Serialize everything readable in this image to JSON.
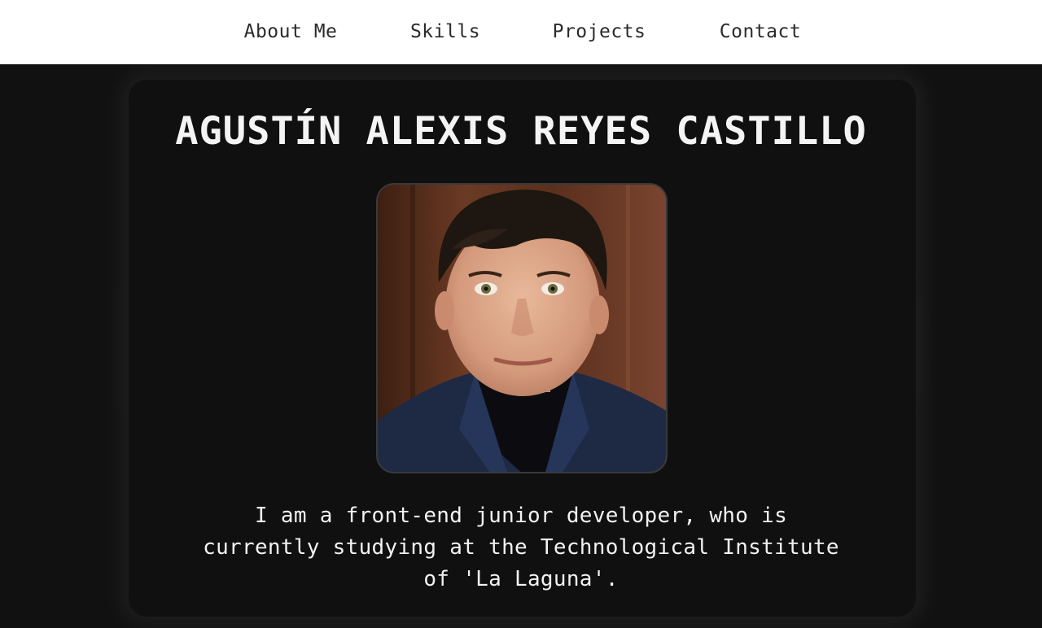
{
  "nav": {
    "items": [
      {
        "label": "About Me"
      },
      {
        "label": "Skills"
      },
      {
        "label": "Projects"
      },
      {
        "label": "Contact"
      }
    ]
  },
  "profile": {
    "name": "AGUSTÍN ALEXIS REYES CASTILLO",
    "bio_line1": "I am a front-end junior developer, who is",
    "bio_line2": "currently studying at the Technological Institute",
    "bio_line3": "of 'La Laguna'."
  },
  "colors": {
    "background": "#111111",
    "card": "#101010",
    "nav_background": "#ffffff",
    "text_light": "#f4f4f4",
    "text_dark": "#2b2b2b"
  }
}
